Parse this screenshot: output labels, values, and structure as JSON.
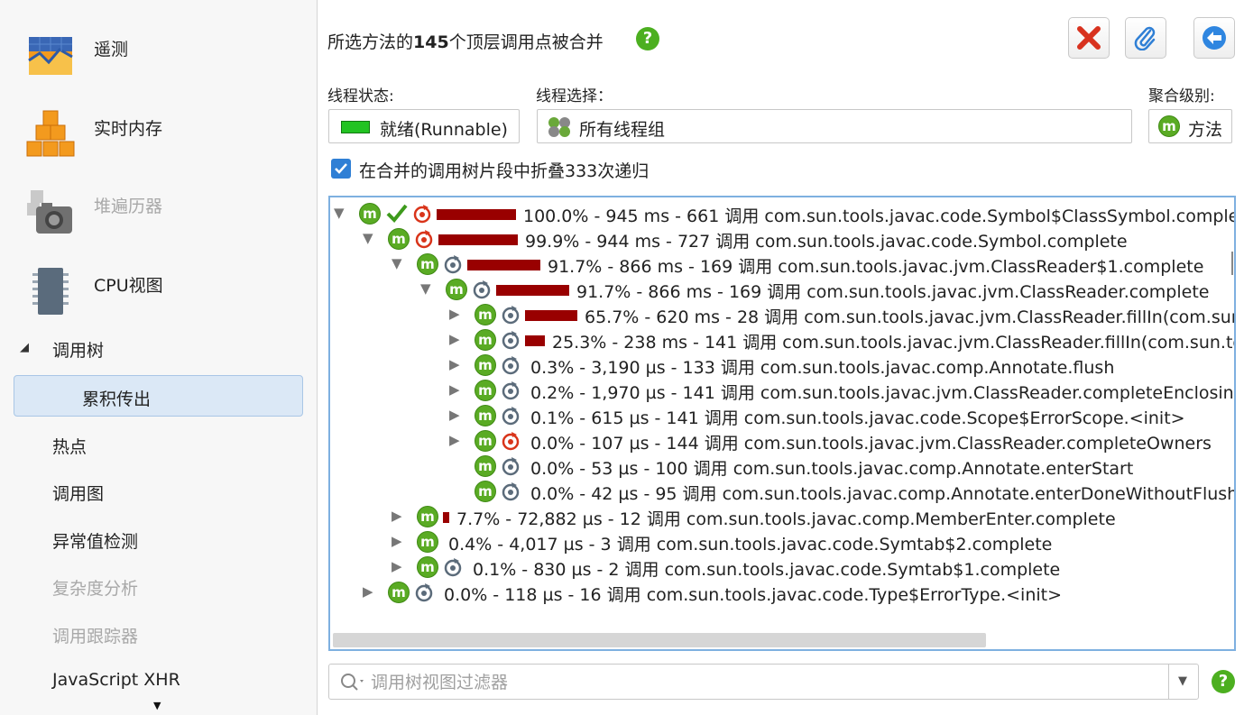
{
  "sidebar": {
    "big_items": [
      {
        "label": "遥测",
        "icon": "telemetry-icon",
        "enabled": true
      },
      {
        "label": "实时内存",
        "icon": "live-memory-icon",
        "enabled": true
      },
      {
        "label": "堆遍历器",
        "icon": "heap-walker-icon",
        "enabled": false
      },
      {
        "label": "CPU视图",
        "icon": "cpu-icon",
        "enabled": true
      }
    ],
    "tree_section": "调用树",
    "nav_items": [
      {
        "label": "累积传出",
        "selected": true,
        "enabled": true
      },
      {
        "label": "热点",
        "selected": false,
        "enabled": true
      },
      {
        "label": "调用图",
        "selected": false,
        "enabled": true
      },
      {
        "label": "异常值检测",
        "selected": false,
        "enabled": true
      },
      {
        "label": "复杂度分析",
        "selected": false,
        "enabled": false
      },
      {
        "label": "调用跟踪器",
        "selected": false,
        "enabled": false
      },
      {
        "label": "JavaScript XHR",
        "selected": false,
        "enabled": true
      }
    ],
    "scroll_down_glyph": "▼"
  },
  "header": {
    "title_prefix": "所选方法的",
    "title_count": "145",
    "title_suffix": "个顶层调用点被合并",
    "help_glyph": "?"
  },
  "toolbar": {
    "buttons": [
      "close-icon",
      "paperclip-icon",
      "back-arrow-icon"
    ]
  },
  "fields": {
    "thread_state_label": "线程状态:",
    "thread_state_value": "就绪(Runnable)",
    "thread_state_color": "#22c322",
    "thread_select_label": "线程选择：",
    "thread_select_value": "所有线程组",
    "aggregation_label": "聚合级别:",
    "aggregation_value": "方法",
    "m_glyph": "m"
  },
  "checkbox": {
    "checked": true,
    "label": "在合并的调用树片段中折叠333次递归"
  },
  "colors": {
    "bar": "#990000",
    "method_icon": "#5aab24",
    "recursion_red": "#d9341a",
    "recursion_gray": "#5b6b7a",
    "selection_border": "#7eb0e0"
  },
  "call_tree": {
    "rows": [
      {
        "depth": 0,
        "expander": "▼",
        "checked": true,
        "recursion": "red",
        "bar": 1.0,
        "text": "100.0% - 945 ms - 661 调用 com.sun.tools.javac.code.Symbol$ClassSymbol.complete"
      },
      {
        "depth": 1,
        "expander": "▼",
        "checked": false,
        "recursion": "red",
        "bar": 0.999,
        "text": "99.9% - 944 ms - 727 调用 com.sun.tools.javac.code.Symbol.complete"
      },
      {
        "depth": 2,
        "expander": "▼",
        "checked": false,
        "recursion": "gray",
        "bar": 0.917,
        "text": "91.7% - 866 ms - 169 调用 com.sun.tools.javac.jvm.ClassReader$1.complete"
      },
      {
        "depth": 3,
        "expander": "▼",
        "checked": false,
        "recursion": "gray",
        "bar": 0.917,
        "text": "91.7% - 866 ms - 169 调用 com.sun.tools.javac.jvm.ClassReader.complete"
      },
      {
        "depth": 4,
        "expander": "▶",
        "checked": false,
        "recursion": "gray",
        "bar": 0.657,
        "text": "65.7% - 620 ms - 28 调用 com.sun.tools.javac.jvm.ClassReader.fillIn(com.sun.tools"
      },
      {
        "depth": 4,
        "expander": "▶",
        "checked": false,
        "recursion": "gray",
        "bar": 0.253,
        "text": "25.3% - 238 ms - 141 调用 com.sun.tools.javac.jvm.ClassReader.fillIn(com.sun.tools"
      },
      {
        "depth": 4,
        "expander": "▶",
        "checked": false,
        "recursion": "gray",
        "bar": 0.003,
        "text": "0.3% - 3,190 µs - 133 调用 com.sun.tools.javac.comp.Annotate.flush"
      },
      {
        "depth": 4,
        "expander": "▶",
        "checked": false,
        "recursion": "gray",
        "bar": 0.002,
        "text": "0.2% - 1,970 µs - 141 调用 com.sun.tools.javac.jvm.ClassReader.completeEnclosing"
      },
      {
        "depth": 4,
        "expander": "▶",
        "checked": false,
        "recursion": "gray",
        "bar": 0.001,
        "text": "0.1% - 615 µs - 141 调用 com.sun.tools.javac.code.Scope$ErrorScope.<init>"
      },
      {
        "depth": 4,
        "expander": "▶",
        "checked": false,
        "recursion": "red",
        "bar": 0.0,
        "text": "0.0% - 107 µs - 144 调用 com.sun.tools.javac.jvm.ClassReader.completeOwners"
      },
      {
        "depth": 4,
        "expander": "",
        "checked": false,
        "recursion": "gray",
        "bar": 0.0,
        "text": "0.0% - 53 µs - 100 调用 com.sun.tools.javac.comp.Annotate.enterStart"
      },
      {
        "depth": 4,
        "expander": "",
        "checked": false,
        "recursion": "gray",
        "bar": 0.0,
        "text": "0.0% - 42 µs - 95 调用 com.sun.tools.javac.comp.Annotate.enterDoneWithoutFlush"
      },
      {
        "depth": 2,
        "expander": "▶",
        "checked": false,
        "recursion": "none",
        "bar": 0.077,
        "text": "7.7% - 72,882 µs - 12 调用 com.sun.tools.javac.comp.MemberEnter.complete"
      },
      {
        "depth": 2,
        "expander": "▶",
        "checked": false,
        "recursion": "none",
        "bar": 0.004,
        "text": "0.4% - 4,017 µs - 3 调用 com.sun.tools.javac.code.Symtab$2.complete"
      },
      {
        "depth": 2,
        "expander": "▶",
        "checked": false,
        "recursion": "gray",
        "bar": 0.001,
        "text": "0.1% - 830 µs - 2 调用 com.sun.tools.javac.code.Symtab$1.complete"
      },
      {
        "depth": 1,
        "expander": "▶",
        "checked": false,
        "recursion": "gray",
        "bar": 0.0,
        "text": "0.0% - 118 µs - 16 调用 com.sun.tools.javac.code.Type$ErrorType.<init>"
      }
    ]
  },
  "filter": {
    "placeholder": "调用树视图过滤器",
    "dropdown_glyph": "▼",
    "help_glyph": "?"
  }
}
